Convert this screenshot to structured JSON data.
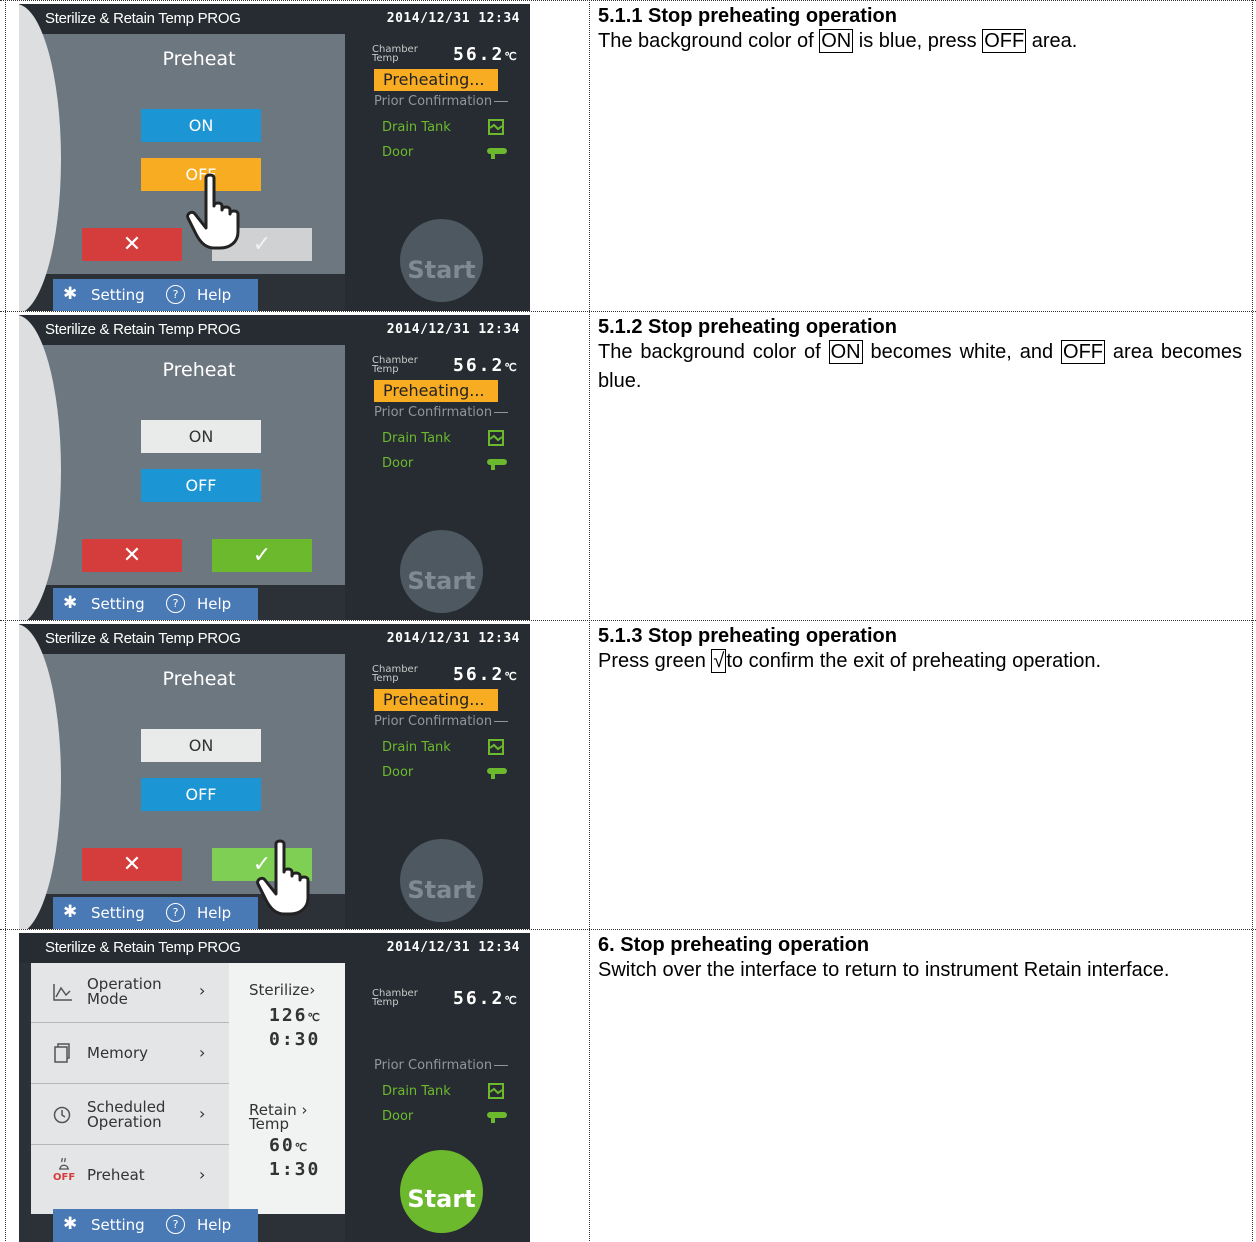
{
  "screen": {
    "title": "Sterilize & Retain Temp PROG",
    "datetime": "2014/12/31 12:34",
    "panel_title": "Preheat",
    "on_label": "ON",
    "off_label": "OFF",
    "cancel_symbol": "✕",
    "confirm_symbol": "✓",
    "chamber_label_1": "Chamber",
    "chamber_label_2": "Temp",
    "chamber_value": "56.2",
    "chamber_unit": "℃",
    "preheating_status": "Preheating...",
    "prior_confirmation": "Prior Confirmation",
    "drain_tank_label": "Drain Tank",
    "door_label": "Door",
    "start_label": "Start",
    "setting_label": "Setting",
    "help_label": "Help",
    "help_symbol": "?"
  },
  "menu_screen": {
    "items": [
      {
        "label_1": "Operation",
        "label_2": "Mode"
      },
      {
        "label_1": "Memory",
        "label_2": ""
      },
      {
        "label_1": "Scheduled",
        "label_2": "Operation"
      },
      {
        "label_1": "Preheat",
        "label_2": ""
      }
    ],
    "preheat_off_tag": "OFF",
    "sterilize_label": "Sterilize",
    "sterilize_temp": "126",
    "sterilize_time": "0:30",
    "retain_label_1": "Retain",
    "retain_label_2": "Temp",
    "retain_temp": "60",
    "retain_time": "1:30",
    "temp_unit": "℃",
    "chevron": "›"
  },
  "steps": [
    {
      "heading": "5.1.1 Stop preheating operation",
      "t1": "The background color of ",
      "b1": "ON",
      "t2": " is blue, press ",
      "b2": "OFF",
      "t3": " area."
    },
    {
      "heading": "5.1.2 Stop preheating operation",
      "t1": "The background color of ",
      "b1": "ON",
      "t2": " becomes white, and ",
      "b2": "OFF",
      "t3": " area becomes blue."
    },
    {
      "heading": "5.1.3 Stop preheating operation",
      "t1": "Press green ",
      "b1": "√",
      "t2": "to confirm the exit of preheating operation."
    },
    {
      "heading": "6. Stop preheating operation",
      "t1": "Switch over the interface to return to instrument Retain interface."
    }
  ],
  "colors": {
    "blue": "#1c95d4",
    "orange": "#f7ac22",
    "red": "#d43d3b",
    "green": "#6cb92e",
    "footer_blue": "#4a7ab5",
    "screen_dark": "#262c31"
  },
  "icons": {
    "gear": "gear-icon",
    "help": "help-icon",
    "drain_tank": "drain-tank-icon",
    "door": "door-key-icon",
    "hand": "pointing-hand-icon"
  }
}
